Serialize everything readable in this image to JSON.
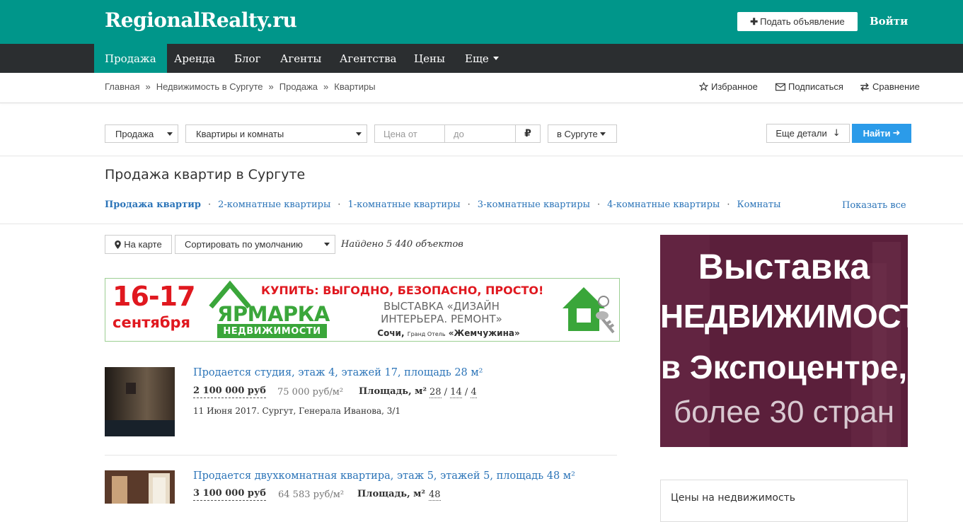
{
  "header": {
    "logo": "RegionalRealty.ru",
    "post_ad_label": "Подать объявление",
    "login_label": "Войти",
    "accent_color": "#00968a"
  },
  "nav": {
    "items": [
      {
        "label": "Продажа",
        "active": true
      },
      {
        "label": "Аренда"
      },
      {
        "label": "Блог"
      },
      {
        "label": "Агенты"
      },
      {
        "label": "Агентства"
      },
      {
        "label": "Цены"
      },
      {
        "label": "Еще"
      }
    ]
  },
  "breadcrumb": {
    "items": [
      "Главная",
      "Недвижимость в Сургуте",
      "Продажа",
      "Квартиры"
    ],
    "separator": "»"
  },
  "tools": {
    "favorites": "Избранное",
    "subscribe": "Подписаться",
    "compare": "Сравнение"
  },
  "filters": {
    "deal_type": "Продажа",
    "property_type": "Квартиры и комнаты",
    "price_from_placeholder": "Цена от",
    "price_to_placeholder": "до",
    "currency": "₽",
    "city": "в Сургуте",
    "more_details": "Еще детали",
    "search": "Найти"
  },
  "page": {
    "title": "Продажа квартир в Сургуте",
    "categories": [
      "Продажа квартир",
      "2-комнатные квартиры",
      "1-комнатные квартиры",
      "3-комнатные квартиры",
      "4-комнатные квартиры",
      "Комнаты"
    ],
    "show_all": "Показать все"
  },
  "results": {
    "map_button": "На карте",
    "sort": "Сортировать по умолчанию",
    "found": "Найдено 5 440 объектов"
  },
  "banner": {
    "date": "16-17",
    "month": "сентября",
    "tagline": "КУПИТЬ: ВЫГОДНО,  БЕЗОПАСНО, ПРОСТО!",
    "fair_title": "ЯРМАРКА",
    "fair_subtitle": "НЕДВИЖИМОСТИ",
    "exhibition": "ВЫСТАВКА «ДИЗАЙН ИНТЕРЬЕРА. РЕМОНТ»",
    "venue_city": "Сочи,",
    "venue_small": "Гранд Отель",
    "venue_name": "«Жемчужина»"
  },
  "listings": [
    {
      "title": "Продается студия, этаж 4, этажей 17, площадь 28 м²",
      "price": "2 100 000 руб",
      "price_per_m2": "75 000 руб/м²",
      "area_label": "Площадь, м²",
      "area_total": "28",
      "area_living": "14",
      "area_kitchen": "4",
      "meta": "11 Июня 2017. Сургут, Генерала Иванова, 3/1"
    },
    {
      "title": "Продается двухкомнатная квартира, этаж 5, этажей 5, площадь 48 м²",
      "price": "3 100 000 руб",
      "price_per_m2": "64 583 руб/м²",
      "area_label": "Площадь, м²",
      "area_total": "48"
    }
  ],
  "side_ad": {
    "line1": "Выставка",
    "line2": "НЕДВИЖИМОСТИ",
    "line3": "в Экспоцентре,",
    "line4": "более 30 стран"
  },
  "side_box": {
    "title": "Цены на недвижимость"
  }
}
